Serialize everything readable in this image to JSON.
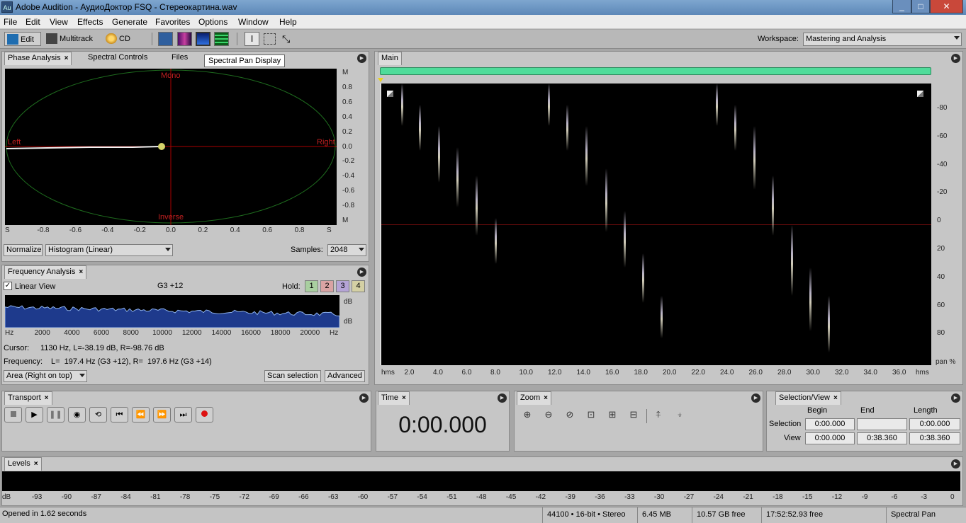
{
  "window": {
    "app_icon": "Au",
    "title": "Adobe Audition - АудиоДоктор FSQ - Стереокартина.wav",
    "min": "_",
    "max": "□",
    "close": "✕"
  },
  "menu": [
    "File",
    "Edit",
    "View",
    "Effects",
    "Generate",
    "Favorites",
    "Options",
    "Window",
    "Help"
  ],
  "toolbar": {
    "edit": "Edit",
    "multitrack": "Multitrack",
    "cd": "CD",
    "workspace_label": "Workspace:",
    "workspace_value": "Mastering and Analysis"
  },
  "tooltip": "Spectral Pan Display",
  "phase": {
    "tabs": [
      "Phase Analysis",
      "Spectral Controls",
      "Files"
    ],
    "label_mono": "Mono",
    "label_inverse": "Inverse",
    "label_left": "Left",
    "label_right": "Right",
    "yticks": [
      "M",
      "0.8",
      "0.6",
      "0.4",
      "0.2",
      "0.0",
      "-0.2",
      "-0.4",
      "-0.6",
      "-0.8",
      "M"
    ],
    "xticks": [
      "S",
      "-0.8",
      "-0.6",
      "-0.4",
      "-0.2",
      "0.0",
      "0.2",
      "0.4",
      "0.6",
      "0.8",
      "S"
    ],
    "normalize": "Normalize",
    "mode": "Histogram (Linear)",
    "samples_label": "Samples:",
    "samples_value": "2048"
  },
  "freq": {
    "tab": "Frequency Analysis",
    "linear_view": "Linear View",
    "note": "G3 +12",
    "hold_label": "Hold:",
    "hold": [
      "1",
      "2",
      "3",
      "4"
    ],
    "xticks": [
      "Hz",
      "2000",
      "4000",
      "6000",
      "8000",
      "10000",
      "12000",
      "14000",
      "16000",
      "18000",
      "20000",
      "Hz"
    ],
    "db_top": "dB",
    "db_bottom": "dB",
    "cursor_label": "Cursor:",
    "cursor_value": "1130 Hz, L=-38.19 dB, R=-98.76 dB",
    "frequency_label": "Frequency:",
    "frequency_value": "L=  197.4 Hz (G3 +12), R=  197.6 Hz (G3 +14)",
    "area_mode": "Area (Right on top)",
    "scan": "Scan selection",
    "advanced": "Advanced"
  },
  "main": {
    "tab": "Main",
    "xticks": [
      "hms",
      "2.0",
      "4.0",
      "6.0",
      "8.0",
      "10.0",
      "12.0",
      "14.0",
      "16.0",
      "18.0",
      "20.0",
      "22.0",
      "24.0",
      "26.0",
      "28.0",
      "30.0",
      "32.0",
      "34.0",
      "36.0",
      "hms"
    ],
    "yticks": [
      "-80",
      "-60",
      "-40",
      "-20",
      "0",
      "20",
      "40",
      "60",
      "80"
    ],
    "y_unit": "pan %"
  },
  "transport": {
    "tab": "Transport"
  },
  "time": {
    "tab": "Time",
    "value": "0:00.000"
  },
  "zoom": {
    "tab": "Zoom"
  },
  "selview": {
    "tab": "Selection/View",
    "col_begin": "Begin",
    "col_end": "End",
    "col_length": "Length",
    "row_selection": "Selection",
    "row_view": "View",
    "sel_begin": "0:00.000",
    "sel_end": "",
    "sel_length": "0:00.000",
    "view_begin": "0:00.000",
    "view_end": "0:38.360",
    "view_length": "0:38.360"
  },
  "levels": {
    "tab": "Levels",
    "ticks": [
      "dB",
      "-93",
      "-90",
      "-87",
      "-84",
      "-81",
      "-78",
      "-75",
      "-72",
      "-69",
      "-66",
      "-63",
      "-60",
      "-57",
      "-54",
      "-51",
      "-48",
      "-45",
      "-42",
      "-39",
      "-36",
      "-33",
      "-30",
      "-27",
      "-24",
      "-21",
      "-18",
      "-15",
      "-12",
      "-9",
      "-6",
      "-3",
      "0"
    ]
  },
  "status": {
    "message": "Opened in 1.62 seconds",
    "format": "44100 • 16-bit • Stereo",
    "size": "6.45 MB",
    "free": "10.57 GB free",
    "time_free": "17:52:52.93 free",
    "view": "Spectral Pan"
  },
  "colors": {
    "accent_green": "#4fdc9a",
    "selection_blue": "#1e3a8c",
    "grid_red": "#8a1010"
  }
}
